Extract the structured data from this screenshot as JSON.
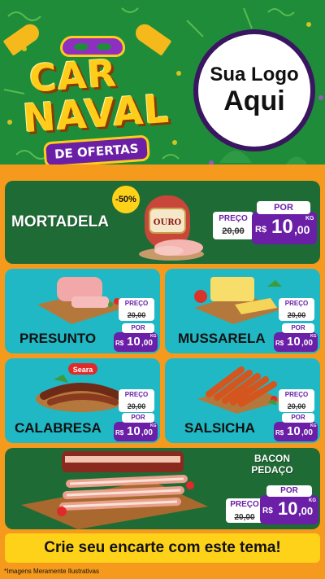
{
  "header": {
    "title_line1": "CAR",
    "title_line2": "NAVAL",
    "subtitle": "DE OFERTAS",
    "logo_line1": "Sua Logo",
    "logo_line2": "Aqui"
  },
  "labels": {
    "preco": "PREÇO",
    "por": "POR",
    "currency": "R$",
    "unit": "KG"
  },
  "products": [
    {
      "name": "MORTADELA",
      "discount": "-50%",
      "old_price": "20,00",
      "new_price_int": "10",
      "new_price_dec": ",00"
    },
    {
      "name": "PRESUNTO",
      "old_price": "20,00",
      "new_price_int": "10",
      "new_price_dec": ",00"
    },
    {
      "name": "MUSSARELA",
      "old_price": "20,00",
      "new_price_int": "10",
      "new_price_dec": ",00"
    },
    {
      "name": "CALABRESA",
      "brand": "Seara",
      "old_price": "20,00",
      "new_price_int": "10",
      "new_price_dec": ",00"
    },
    {
      "name": "SALSICHA",
      "old_price": "20,00",
      "new_price_int": "10",
      "new_price_dec": ",00"
    },
    {
      "name": "BACON PEDAÇO",
      "name_line1": "BACON",
      "name_line2": "PEDAÇO",
      "old_price": "20,00",
      "new_price_int": "10",
      "new_price_dec": ",00"
    }
  ],
  "mortadela_brand": "OURO",
  "banner": "Crie seu encarte com este tema!",
  "footnote": "*Imagens Meramente Ilustrativas",
  "colors": {
    "green": "#1f6b35",
    "teal": "#1fb8c4",
    "purple": "#6a1fa6",
    "yellow": "#ffd21a",
    "orange": "#f59a1c"
  }
}
